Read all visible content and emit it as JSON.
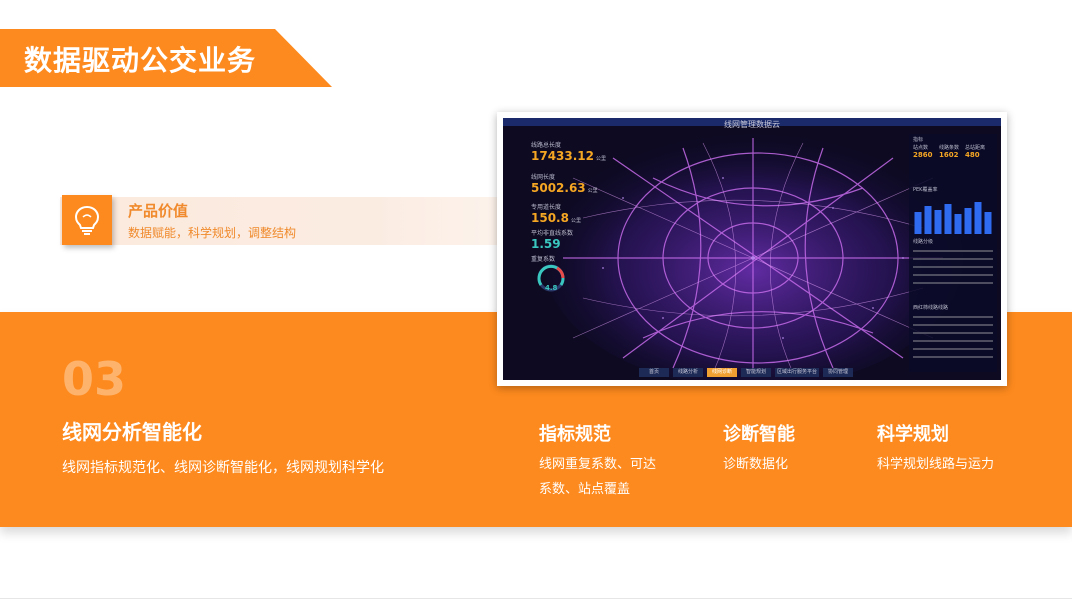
{
  "page": {
    "title": "数据驱动公交业务"
  },
  "product_value": {
    "title": "产品价值",
    "subtitle": "数据赋能，科学规划，调整结构",
    "icon": "lightbulb-icon"
  },
  "section": {
    "number": "03",
    "title": "线网分析智能化",
    "description": "线网指标规范化、线网诊断智能化，线网规划科学化"
  },
  "features": [
    {
      "title": "指标规范",
      "description": "线网重复系数、可达系数、站点覆盖"
    },
    {
      "title": "诊断智能",
      "description": "诊断数据化"
    },
    {
      "title": "科学规划",
      "description": "科学规划线路与运力"
    }
  ],
  "dashboard": {
    "title": "线网管理数据云",
    "metrics": [
      {
        "label": "线路总长度",
        "value": "17433.12",
        "unit": "公里",
        "color": "#f5a623"
      },
      {
        "label": "线网长度",
        "value": "5002.63",
        "unit": "公里",
        "color": "#f5a623"
      },
      {
        "label": "专用道长度",
        "value": "150.8",
        "unit": "公里",
        "color": "#f5a623"
      },
      {
        "label": "平均非直线系数",
        "value": "1.59",
        "unit": "",
        "color": "#3ac7c0"
      }
    ],
    "gauge_label": "重复系数",
    "gauge_value": "4.8",
    "right_panel": {
      "header": "指标",
      "stat_labels": [
        "站点数",
        "线路条数",
        "总站距离"
      ],
      "stat_values": [
        "2860",
        "1602",
        "480"
      ],
      "chart_title": "PEK覆盖率",
      "table1_title": "线路分级",
      "table2_title": "西红柿线路线路",
      "bar_values": [
        0.55,
        0.7,
        0.6,
        0.75,
        0.5,
        0.65,
        0.8,
        0.55
      ]
    },
    "nav_buttons": [
      "首页",
      "线路分析",
      "线网诊断",
      "智能规划",
      "区域出行服务平台",
      "协同管理"
    ],
    "active_nav": 2
  },
  "colors": {
    "accent": "#fd8a1e",
    "light_strip": "#fbe9dc",
    "dashboard_bg": "#0d0a22"
  }
}
